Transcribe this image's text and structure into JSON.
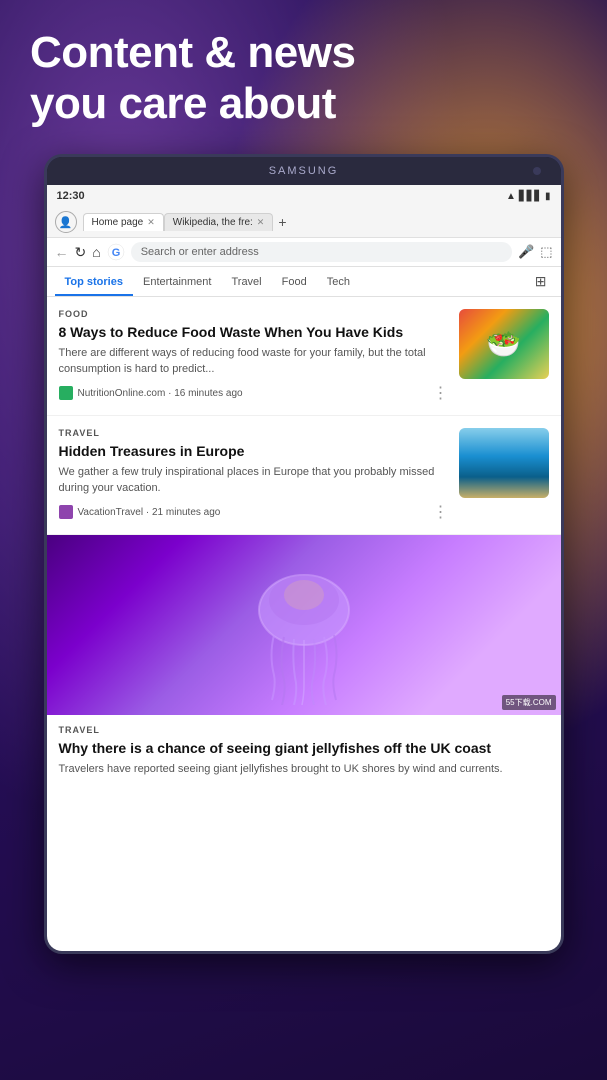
{
  "background": {
    "headline_line1": "Content & news",
    "headline_line2": "you care about"
  },
  "phone": {
    "brand": "SAMSUNG",
    "status": {
      "time": "12:30"
    },
    "browser": {
      "tabs": [
        {
          "label": "Home page",
          "active": true
        },
        {
          "label": "Wikipedia, the fre:",
          "active": false
        }
      ],
      "address_placeholder": "Search or enter address"
    },
    "nav_tabs": [
      {
        "label": "Top stories",
        "active": true
      },
      {
        "label": "Entertainment",
        "active": false
      },
      {
        "label": "Travel",
        "active": false
      },
      {
        "label": "Food",
        "active": false
      },
      {
        "label": "Tech",
        "active": false
      }
    ],
    "articles": [
      {
        "category": "FOOD",
        "title": "8 Ways to Reduce Food Waste When You Have Kids",
        "description": "There are different ways of reducing food waste for your family, but the total consumption is hard to predict...",
        "source": "NutritionOnline.com",
        "time": "16 minutes ago",
        "thumb_type": "food"
      },
      {
        "category": "TRAVEL",
        "title": "Hidden Treasures in Europe",
        "description": "We gather a few truly inspirational places in Europe that you probably missed during your vacation.",
        "source": "VacationTravel",
        "time": "21 minutes ago",
        "thumb_type": "travel"
      },
      {
        "category": "TRAVEL",
        "title": "Why there is a chance of seeing giant jellyfishes off the UK coast",
        "description": "Travelers have reported seeing giant jellyfishes brought to UK shores by wind and currents.",
        "large": true,
        "thumb_type": "jellyfish"
      }
    ],
    "watermark": "55下载.COM"
  }
}
